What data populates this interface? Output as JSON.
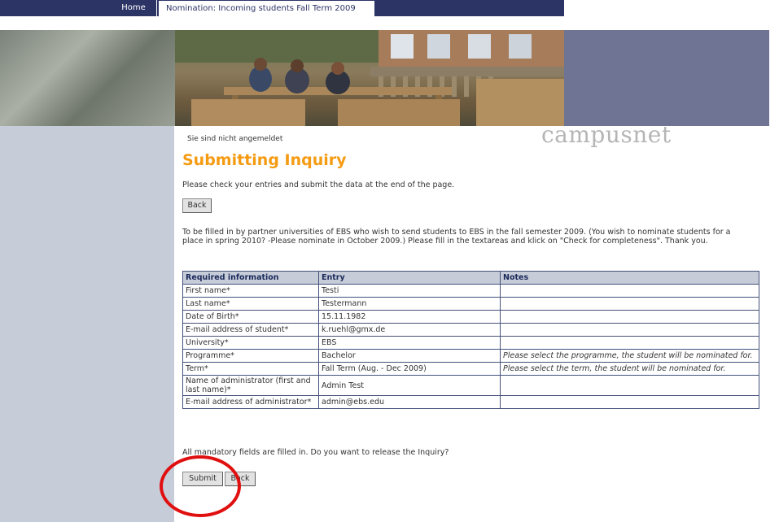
{
  "nav": {
    "home": "Home",
    "current_tab": "Nomination: Incoming students Fall Term 2009"
  },
  "header": {
    "login_status": "Sie sind nicht angemeldet",
    "brand": "campusnet"
  },
  "page": {
    "title": "Submitting Inquiry",
    "intro": "Please check your entries and submit the data at the end of the page.",
    "back_label": "Back",
    "description": "To be filled in by partner universities of EBS who wish to send students to EBS in the fall semester 2009. (You wish to nominate students for a place in spring 2010? -Please nominate in October 2009.) Please fill in the textareas and klick on \"Check for completeness\". Thank you."
  },
  "table": {
    "headers": [
      "Required information",
      "Entry",
      "Notes"
    ],
    "rows": [
      {
        "label": "First name*",
        "entry": "Testi",
        "note": ""
      },
      {
        "label": "Last name*",
        "entry": "Testermann",
        "note": ""
      },
      {
        "label": "Date of Birth*",
        "entry": "15.11.1982",
        "note": ""
      },
      {
        "label": "E-mail address of student*",
        "entry": "k.ruehl@gmx.de",
        "note": ""
      },
      {
        "label": "University*",
        "entry": "EBS",
        "note": ""
      },
      {
        "label": "Programme*",
        "entry": "Bachelor",
        "note": "Please select the programme, the student will be nominated for."
      },
      {
        "label": "Term*",
        "entry": "Fall Term (Aug. - Dec 2009)",
        "note": "Please select the term, the student will be nominated for."
      },
      {
        "label": "Name of administrator (first and last name)*",
        "entry": "Admin Test",
        "note": ""
      },
      {
        "label": "E-mail address of administrator*",
        "entry": "admin@ebs.edu",
        "note": ""
      }
    ]
  },
  "footer": {
    "mandatory_text": "All mandatory fields are filled in. Do you want to release the Inquiry?",
    "submit_label": "Submit",
    "back_label": "Back"
  },
  "colors": {
    "nav_bg": "#2c3466",
    "title": "#f59b12",
    "sidebar": "#c7ccd9",
    "table_header": "#c7ccd9",
    "highlight": "#e01010"
  }
}
